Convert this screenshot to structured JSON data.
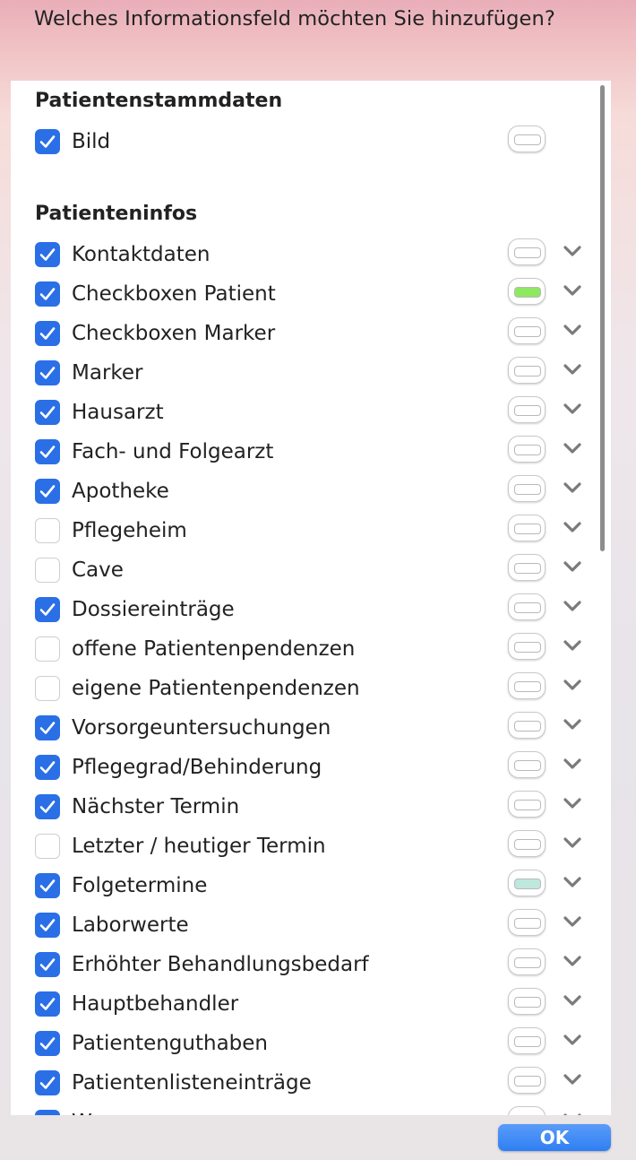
{
  "dialog": {
    "title": "Welches Informationsfeld möchten Sie hinzufügen?",
    "ok_label": "OK"
  },
  "sections": [
    {
      "title": "Patientenstammdaten",
      "items": [
        {
          "label": "Bild",
          "checked": true,
          "color": "#ffffff",
          "has_menu": false
        }
      ]
    },
    {
      "title": "Patienteninfos",
      "items": [
        {
          "label": "Kontaktdaten",
          "checked": true,
          "color": "#ffffff",
          "has_menu": true
        },
        {
          "label": "Checkboxen Patient",
          "checked": true,
          "color": "#8ee862",
          "has_menu": true
        },
        {
          "label": "Checkboxen Marker",
          "checked": true,
          "color": "#ffffff",
          "has_menu": true
        },
        {
          "label": "Marker",
          "checked": true,
          "color": "#ffffff",
          "has_menu": true
        },
        {
          "label": "Hausarzt",
          "checked": true,
          "color": "#ffffff",
          "has_menu": true
        },
        {
          "label": "Fach- und Folgearzt",
          "checked": true,
          "color": "#ffffff",
          "has_menu": true
        },
        {
          "label": "Apotheke",
          "checked": true,
          "color": "#ffffff",
          "has_menu": true
        },
        {
          "label": "Pflegeheim",
          "checked": false,
          "color": "#ffffff",
          "has_menu": true
        },
        {
          "label": "Cave",
          "checked": false,
          "color": "#ffffff",
          "has_menu": true
        },
        {
          "label": "Dossiereinträge",
          "checked": true,
          "color": "#ffffff",
          "has_menu": true
        },
        {
          "label": "offene Patientenpendenzen",
          "checked": false,
          "color": "#ffffff",
          "has_menu": true
        },
        {
          "label": "eigene Patientenpendenzen",
          "checked": false,
          "color": "#ffffff",
          "has_menu": true
        },
        {
          "label": "Vorsorgeuntersuchungen",
          "checked": true,
          "color": "#ffffff",
          "has_menu": true
        },
        {
          "label": "Pflegegrad/Behinderung",
          "checked": true,
          "color": "#ffffff",
          "has_menu": true
        },
        {
          "label": "Nächster Termin",
          "checked": true,
          "color": "#ffffff",
          "has_menu": true
        },
        {
          "label": "Letzter / heutiger Termin",
          "checked": false,
          "color": "#ffffff",
          "has_menu": true
        },
        {
          "label": "Folgetermine",
          "checked": true,
          "color": "#bfe8dc",
          "has_menu": true
        },
        {
          "label": "Laborwerte",
          "checked": true,
          "color": "#ffffff",
          "has_menu": true
        },
        {
          "label": "Erhöhter Behandlungsbedarf",
          "checked": true,
          "color": "#ffffff",
          "has_menu": true
        },
        {
          "label": "Hauptbehandler",
          "checked": true,
          "color": "#ffffff",
          "has_menu": true
        },
        {
          "label": "Patientenguthaben",
          "checked": true,
          "color": "#ffffff",
          "has_menu": true
        },
        {
          "label": "Patientenlisteneinträge",
          "checked": true,
          "color": "#ffffff",
          "has_menu": true
        },
        {
          "label": "W",
          "checked": true,
          "color": "#ffffff",
          "has_menu": true
        }
      ]
    }
  ],
  "icons": {
    "checkbox": "checkmark-icon",
    "swatch": "color-swatch-icon",
    "menu": "chevron-down-icon"
  }
}
